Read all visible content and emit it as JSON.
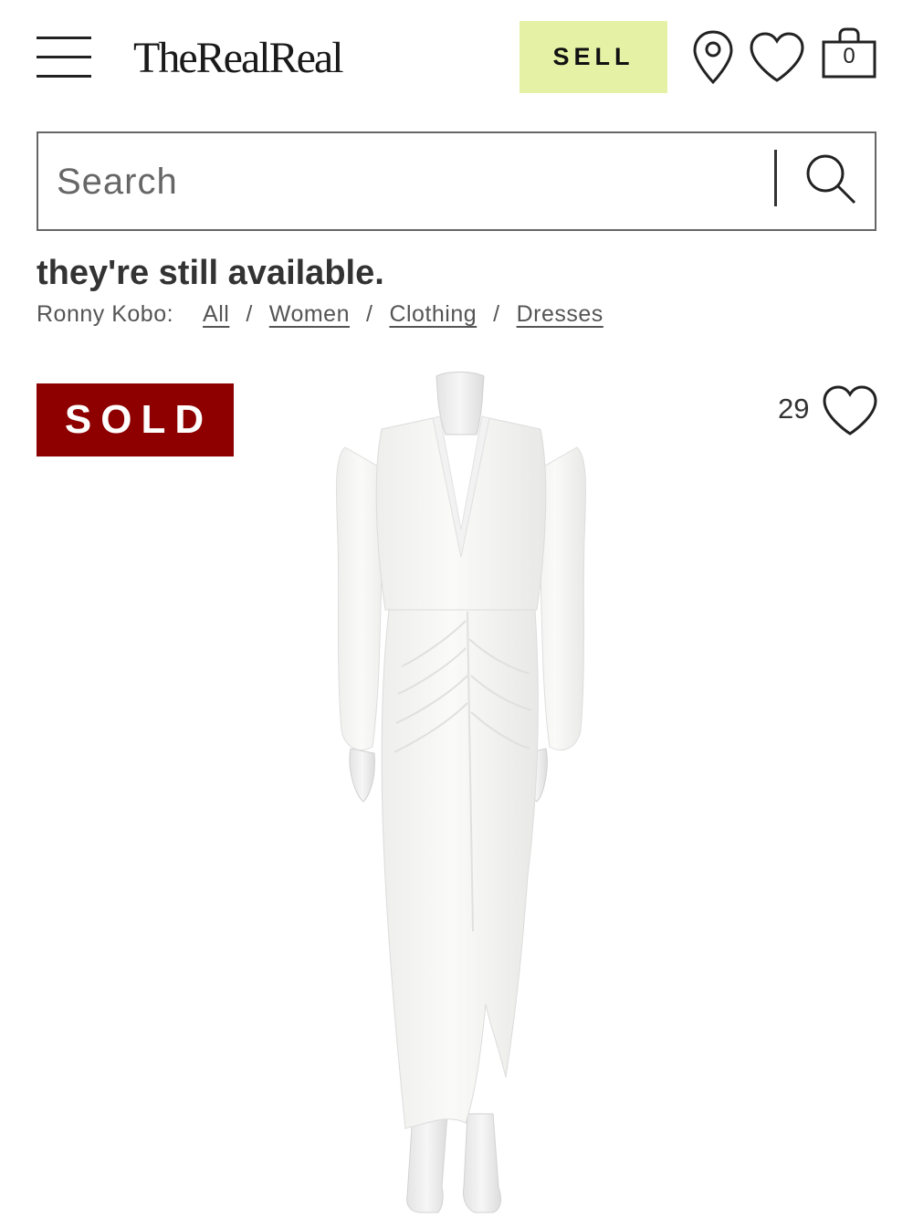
{
  "header": {
    "logo_text": "TheRealReal",
    "sell_label": "SELL",
    "sell_color": "#e5f1a4",
    "bag_count": "0",
    "icons": [
      "menu-icon",
      "location-pin-icon",
      "heart-icon",
      "shopping-bag-icon"
    ]
  },
  "search": {
    "placeholder": "Search",
    "value": "",
    "icon": "search-icon"
  },
  "page": {
    "headline": "they're still available.",
    "breadcrumb": {
      "brand": "Ronny Kobo:",
      "items": [
        "All",
        "Women",
        "Clothing",
        "Dresses"
      ],
      "separator": "/"
    }
  },
  "product": {
    "status_badge": "SOLD",
    "badge_color": "#8e0000",
    "likes": "29",
    "image_alt": "white long-sleeve ruched maxi dress on mannequin"
  }
}
